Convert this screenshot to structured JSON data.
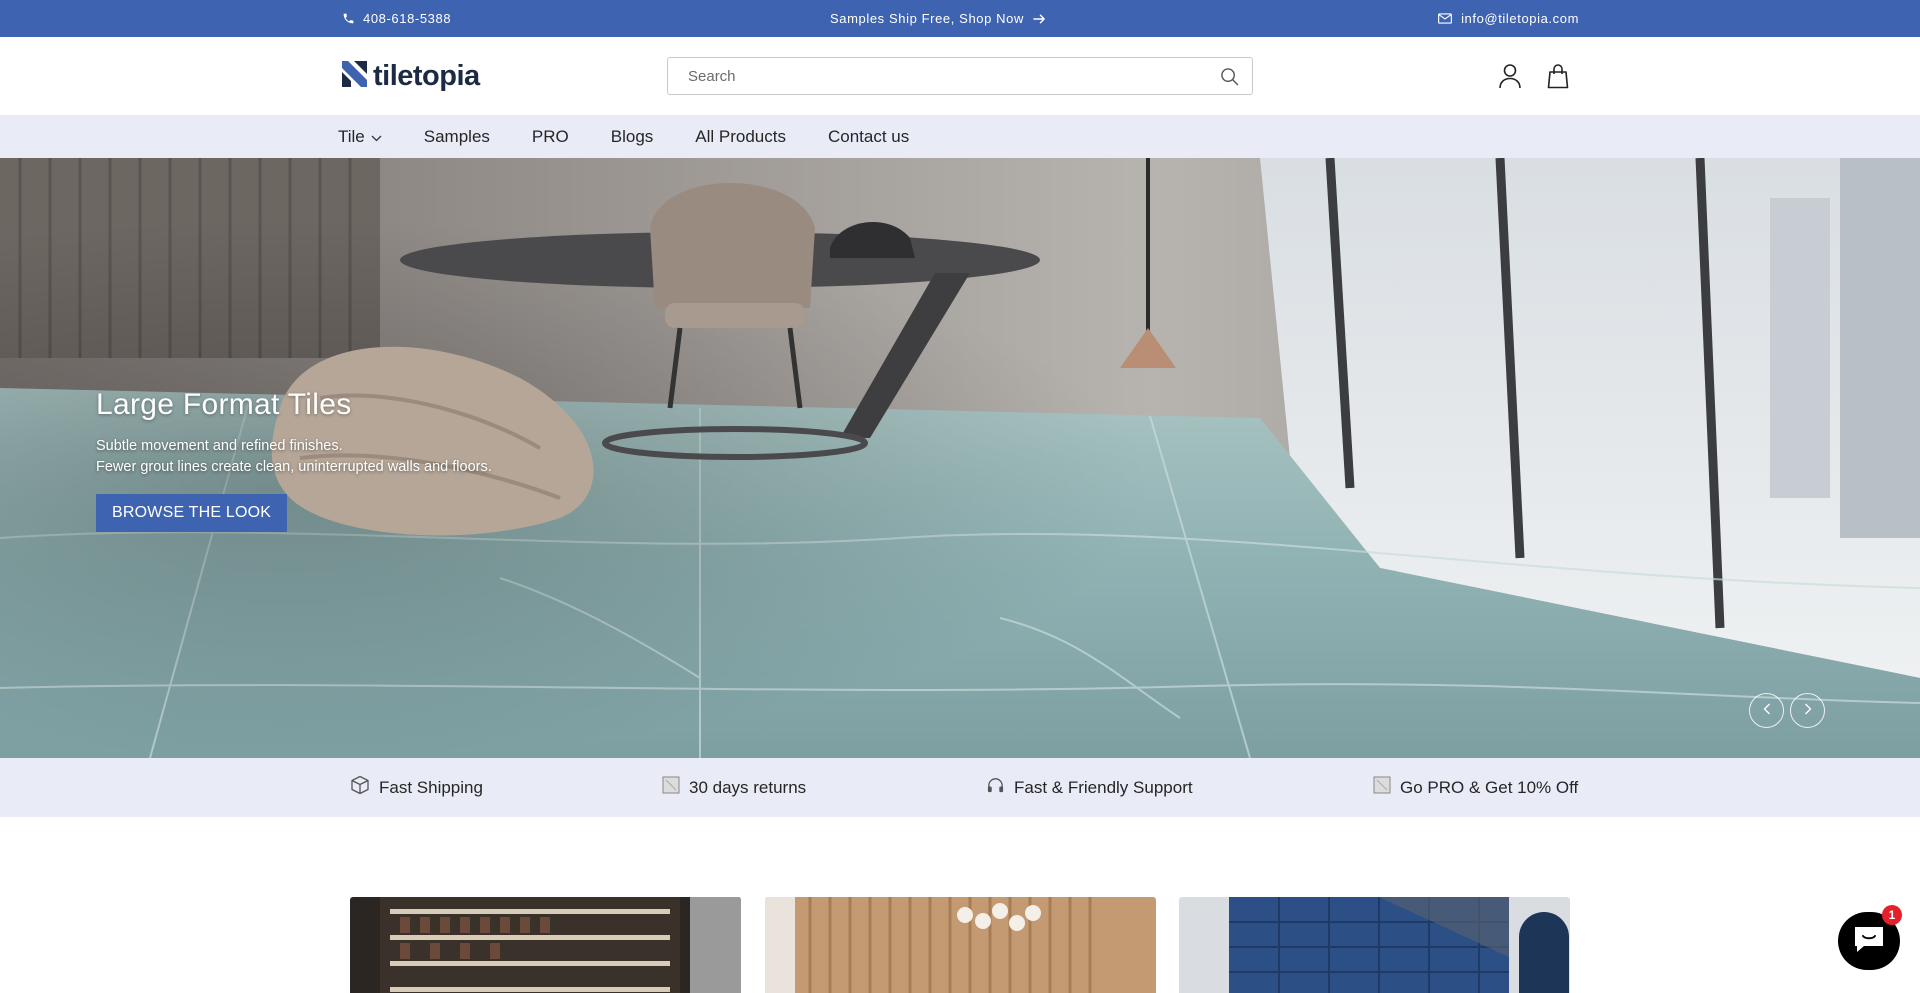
{
  "announcement": {
    "phone": "408-618-5388",
    "promo": "Samples Ship Free, Shop Now",
    "email": "info@tiletopia.com"
  },
  "header": {
    "logo_text": "tiletopia",
    "search_placeholder": "Search",
    "icons": [
      "search-icon",
      "account-icon",
      "cart-icon"
    ]
  },
  "nav": {
    "items": [
      "Tile",
      "Samples",
      "PRO",
      "Blogs",
      "All Products",
      "Contact us"
    ]
  },
  "hero": {
    "title": "Large Format Tiles",
    "subtitle_line1": "Subtle movement and refined finishes.",
    "subtitle_line2": "Fewer grout lines create clean, uninterrupted walls and floors.",
    "button": "BROWSE THE LOOK"
  },
  "features": [
    {
      "label": "Fast Shipping",
      "icon": "box-icon"
    },
    {
      "label": "30 days returns",
      "icon": "returns-icon"
    },
    {
      "label": "Fast & Friendly Support",
      "icon": "headset-icon"
    },
    {
      "label": "Go PRO & Get 10% Off",
      "icon": "pro-icon"
    }
  ],
  "chat": {
    "badge_count": "1"
  },
  "colors": {
    "brand": "#3e63b0",
    "nav_bg": "#e9ecf7",
    "logo": "#1d2a44"
  }
}
